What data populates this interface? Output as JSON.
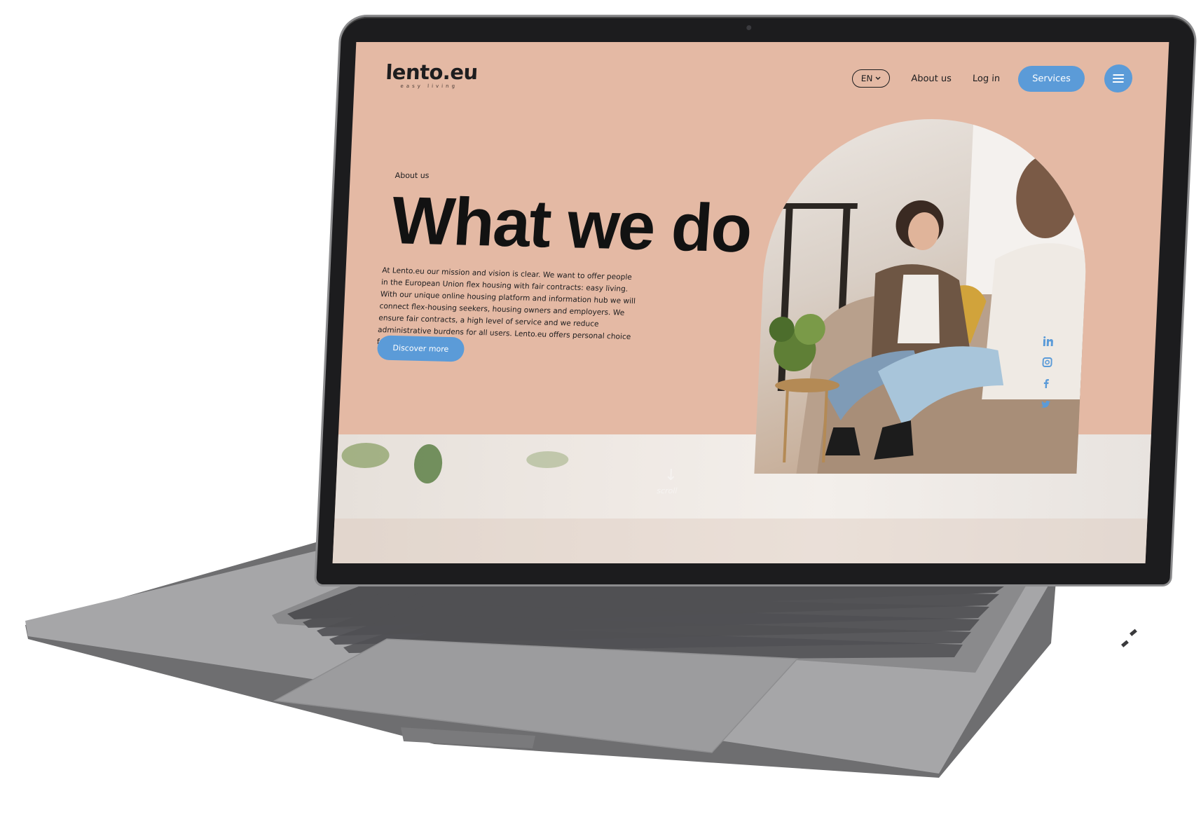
{
  "site": {
    "logo_text": "lento.eu",
    "logo_tagline": "easy living"
  },
  "nav": {
    "language": "EN",
    "about_label": "About us",
    "login_label": "Log in",
    "services_label": "Services"
  },
  "hero": {
    "eyebrow": "About us",
    "title": "What we do",
    "body": "At Lento.eu our mission and vision is clear. We want to offer people in the European Union flex housing with fair contracts: easy living. With our unique online housing platform and information hub we will connect flex-housing seekers, housing owners and employers. We ensure fair contracts, a high level of service and we reduce administrative burdens for all users. Lento.eu offers personal choice for flex housing.",
    "cta_label": "Discover more"
  },
  "social": {
    "icons": [
      "linkedin-icon",
      "instagram-icon",
      "facebook-icon",
      "twitter-icon"
    ]
  },
  "scroll": {
    "arrow": "↓",
    "label": "scroll"
  },
  "colors": {
    "hero_bg": "#e4b9a4",
    "accent": "#5b9bd8",
    "text": "#1d1d1f"
  }
}
